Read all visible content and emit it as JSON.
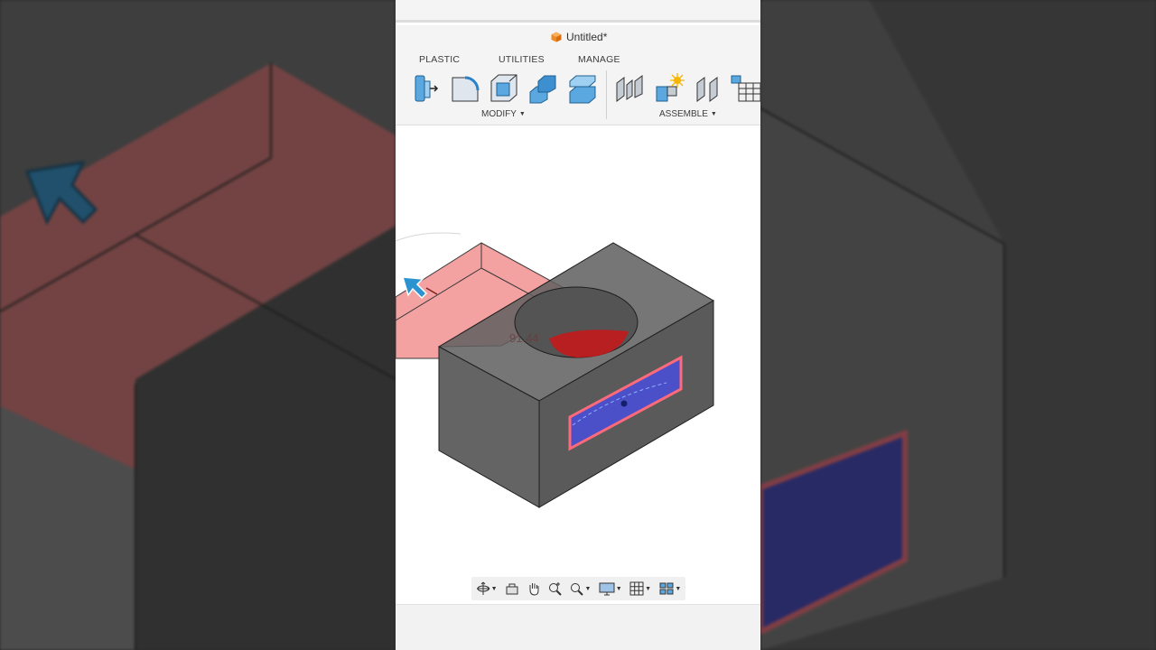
{
  "document": {
    "title": "Untitled*",
    "icon": "orange-cube-icon"
  },
  "ribbon": {
    "tabs": [
      {
        "label": "PLASTIC"
      },
      {
        "label": "UTILITIES"
      },
      {
        "label": "MANAGE"
      }
    ],
    "groups": [
      {
        "label": "MODIFY",
        "tools": [
          "press-pull-icon",
          "fillet-icon",
          "shell-icon",
          "combine-icon",
          "offset-face-icon"
        ]
      },
      {
        "label": "ASSEMBLE",
        "tools": [
          "joint-icon",
          "new-component-icon",
          "as-built-joint-icon",
          "table-icon"
        ]
      }
    ]
  },
  "viewport": {
    "dimension_value": "91.44",
    "colors": {
      "extrude_preview": "#f08a8a",
      "body": "#5d5d5d",
      "selected_face": "#4b50c8",
      "selected_outline": "#ff6a7a",
      "manipulator_arrow": "#2a93d0"
    }
  },
  "navigation_bar": {
    "tools": [
      "orbit-icon",
      "look-at-icon",
      "pan-icon",
      "zoom-window-icon",
      "zoom-icon",
      "display-settings-icon",
      "grid-icon",
      "viewports-icon"
    ]
  }
}
